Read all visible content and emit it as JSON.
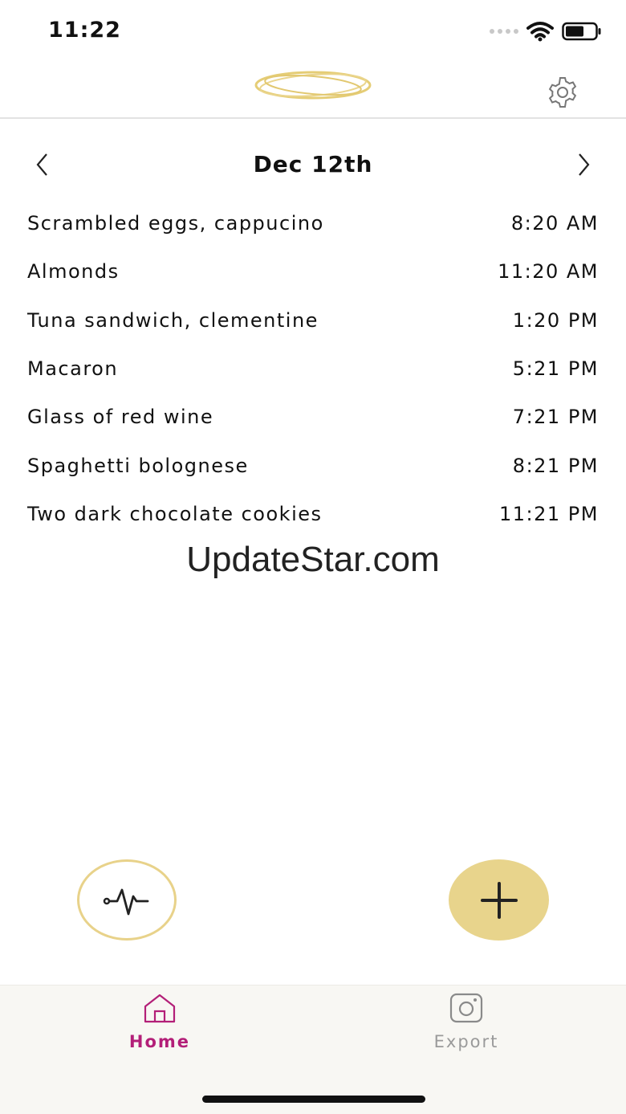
{
  "status_bar": {
    "time": "11:22"
  },
  "date_nav": {
    "title": "Dec 12th"
  },
  "entries": [
    {
      "name": "Scrambled eggs, cappucino",
      "time": "8:20 AM"
    },
    {
      "name": "Almonds",
      "time": "11:20 AM"
    },
    {
      "name": "Tuna sandwich, clementine",
      "time": "1:20 PM"
    },
    {
      "name": "Macaron",
      "time": "5:21 PM"
    },
    {
      "name": "Glass of red wine",
      "time": "7:21 PM"
    },
    {
      "name": "Spaghetti bolognese",
      "time": "8:21 PM"
    },
    {
      "name": "Two dark chocolate cookies",
      "time": "11:21 PM"
    }
  ],
  "watermark": "UpdateStar.com",
  "tabbar": {
    "home_label": "Home",
    "export_label": "Export"
  },
  "colors": {
    "accent_gold": "#e8d48c",
    "active_tab": "#b31f78",
    "inactive_tab": "#9a9a9a"
  },
  "icons": {
    "logo": "gold-rings-logo",
    "settings": "gear-icon",
    "prev": "chevron-left-icon",
    "next": "chevron-right-icon",
    "pulse": "heartbeat-icon",
    "add": "plus-icon",
    "home": "home-icon",
    "export": "camera-icon"
  }
}
